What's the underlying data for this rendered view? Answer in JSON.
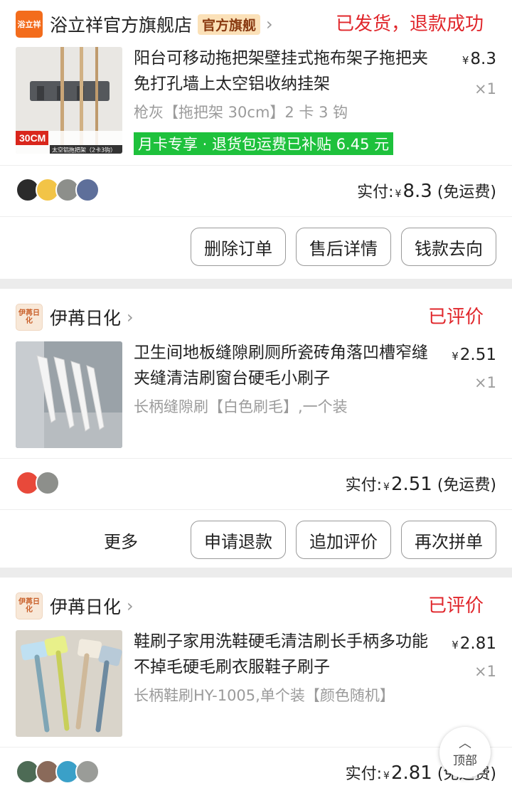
{
  "orders": [
    {
      "store_logo_text": "浴立祥",
      "store_name": "浴立祥官方旗舰店",
      "store_badge": "官方旗舰",
      "status": "已发货，退款成功",
      "title": "阳台可移动拖把架壁挂式拖布架子拖把夹免打孔墙上太空铝收纳挂架",
      "spec": "枪灰【拖把架 30cm】2 卡 3 钩",
      "promo": "月卡专享 · 退货包运费已补贴 6.45 元",
      "price_symbol": "¥",
      "price": "8.3",
      "qty": "×1",
      "paid_label": "实付:",
      "paid_symbol": "¥",
      "paid_amount": "8.3",
      "paid_note": "(免运费)",
      "thumb_tag": "30CM",
      "thumb_caption": "太空铝拖把架（2卡3钩）",
      "buttons": [
        "删除订单",
        "售后详情",
        "钱款去向"
      ]
    },
    {
      "store_logo_text": "伊苒日化",
      "store_name": "伊苒日化",
      "status": "已评价",
      "title": "卫生间地板缝隙刷厕所瓷砖角落凹槽窄缝夹缝清洁刷窗台硬毛小刷子",
      "spec": "长柄缝隙刷【白色刷毛】,一个装",
      "price_symbol": "¥",
      "price": "2.51",
      "qty": "×1",
      "paid_label": "实付:",
      "paid_symbol": "¥",
      "paid_amount": "2.51",
      "paid_note": "(免运费)",
      "more": "更多",
      "buttons": [
        "申请退款",
        "追加评价",
        "再次拼单"
      ]
    },
    {
      "store_logo_text": "伊苒日化",
      "store_name": "伊苒日化",
      "status": "已评价",
      "title": "鞋刷子家用洗鞋硬毛清洁刷长手柄多功能不掉毛硬毛刷衣服鞋子刷子",
      "spec": "长柄鞋刷HY-1005,单个装【颜色随机】",
      "price_symbol": "¥",
      "price": "2.81",
      "qty": "×1",
      "paid_label": "实付:",
      "paid_symbol": "¥",
      "paid_amount": "2.81",
      "paid_note": "(免运费)"
    }
  ],
  "fab": {
    "label": "顶部"
  },
  "colors": {
    "status_red": "#e0262b",
    "promo_green": "#1ec13c",
    "brand_orange": "#f36c1c"
  }
}
